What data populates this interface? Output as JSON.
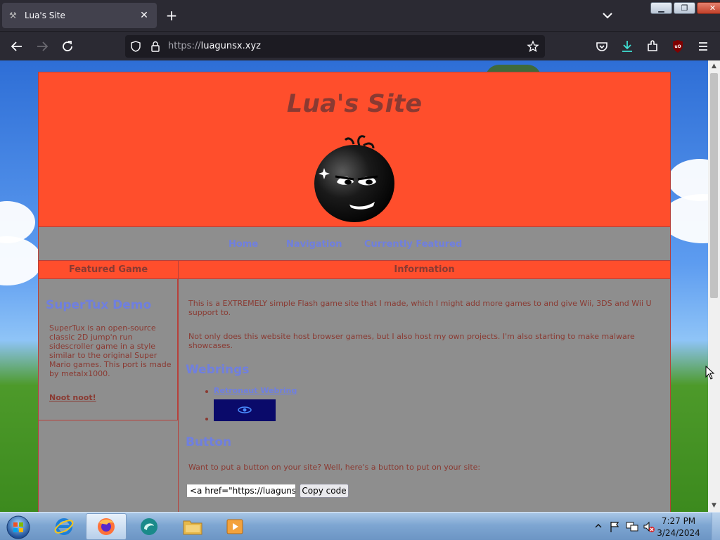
{
  "browser": {
    "tab": {
      "title": "Lua's Site",
      "favicon": "site-favicon-icon"
    },
    "url": {
      "prefix": "https://",
      "host": "luagunsx.xyz"
    }
  },
  "site": {
    "title": "Lua's Site",
    "nav": [
      "Home",
      "Navigation",
      "Currently Featured"
    ],
    "left_heading": "Featured Game",
    "right_heading": "Information",
    "featured": {
      "title": "SuperTux Demo",
      "description": "SuperTux is an open-source classic 2D jump'n run sidescroller game in a style similar to the original Super Mario games. This port is made by metalx1000.",
      "link": "Noot noot!"
    },
    "info": {
      "p1": "This is a EXTREMELY simple Flash game site that I made, which I might add more games to and give Wii, 3DS and Wii U support to.",
      "p2": "Not only does this website host browser games, but I also host my own projects. I'm also starting to make malware showcases.",
      "webrings_heading": "Webrings",
      "webring_link": "Retronaut Webring",
      "button_heading": "Button",
      "button_text": "Want to put a button on your site? Well, here's a button to put on your site:",
      "code_value": "<a href=\"https://luagunsx",
      "copy_label": "Copy code"
    }
  },
  "taskbar": {
    "time": "7:27 PM",
    "date": "3/24/2024"
  },
  "colors": {
    "header": "#ff4e2c",
    "body": "#8e8e8e",
    "link": "#6f7fe0",
    "text": "#8a3a32"
  }
}
